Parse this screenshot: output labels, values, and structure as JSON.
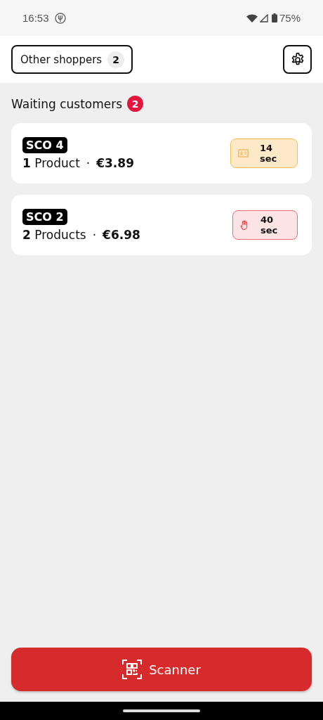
{
  "status_bar": {
    "time": "16:53",
    "battery": "75%"
  },
  "header": {
    "other_shoppers": {
      "label": "Other shoppers",
      "count": "2"
    }
  },
  "waiting": {
    "title": "Waiting customers",
    "count": "2",
    "customers": [
      {
        "station": "SCO 4",
        "quantity": "**1** Product",
        "separator": "·",
        "price": "€3.89",
        "kind": "id",
        "wait": "14 sec"
      },
      {
        "station": "SCO 2",
        "quantity": "**2** Products",
        "separator": "·",
        "price": "€6.98",
        "kind": "hand",
        "wait": "40 sec"
      }
    ]
  },
  "scanner_button": {
    "label": "Scanner"
  }
}
